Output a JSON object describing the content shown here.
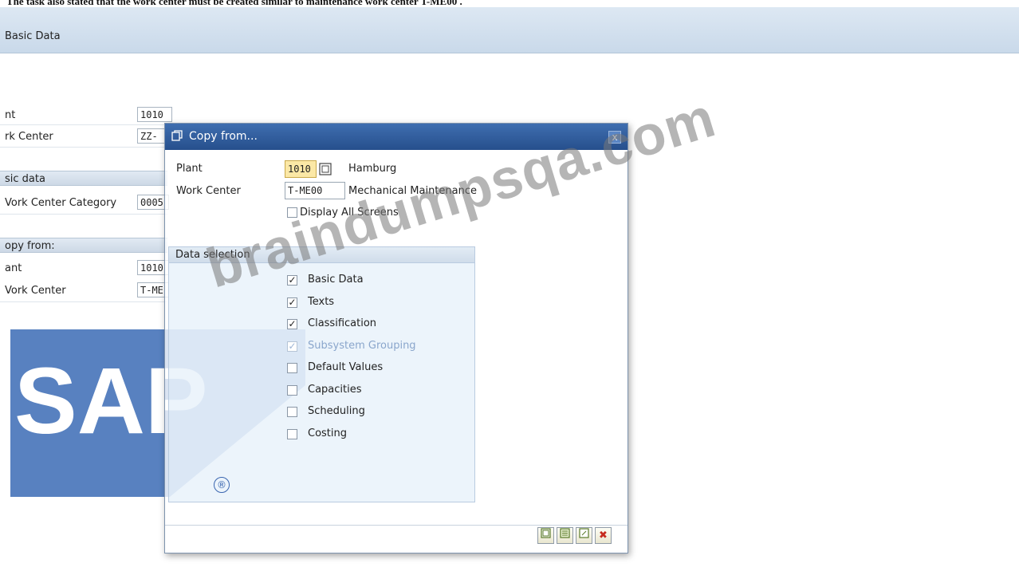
{
  "top_caption": "The task also stated that the work center must be created similar to maintenance work center T-ME00 .",
  "background": {
    "tab_title": "Basic Data",
    "plant_label": "nt",
    "plant_value": "1010",
    "work_center_label": "rk Center",
    "work_center_value": "ZZ-",
    "basic_data_group": "sic data",
    "work_center_category_label": "Vork Center Category",
    "work_center_category_value": "0005",
    "copy_from_group": "opy from:",
    "copy_plant_label": "ant",
    "copy_plant_value": "1010",
    "copy_work_center_label": "Vork Center",
    "copy_work_center_value": "T-ME"
  },
  "watermark": "braindumpsqa.com",
  "logo_text": "SAP",
  "logo_mark": "®",
  "dialog": {
    "title": "Copy from...",
    "close_glyph": "x",
    "plant_label": "Plant",
    "plant_value": "1010",
    "plant_desc": "Hamburg",
    "work_center_label": "Work Center",
    "work_center_value": "T-ME00",
    "work_center_desc": "Mechanical Maintenance",
    "display_all_label": "Display All Screens",
    "data_selection_title": "Data selection",
    "options": [
      {
        "label": "Basic Data",
        "checked": "✓"
      },
      {
        "label": "Texts",
        "checked": "✓"
      },
      {
        "label": "Classification",
        "checked": "✓"
      },
      {
        "label": "Subsystem Grouping",
        "checked": "✓"
      },
      {
        "label": "Default Values",
        "checked": ""
      },
      {
        "label": "Capacities",
        "checked": ""
      },
      {
        "label": "Scheduling",
        "checked": ""
      },
      {
        "label": "Costing",
        "checked": ""
      }
    ],
    "cancel_glyph": "✖"
  },
  "colors": {
    "title_bar": "#2c5a9c",
    "sap_blue": "#3b6bb5",
    "focus_field": "#fbe8a6"
  }
}
